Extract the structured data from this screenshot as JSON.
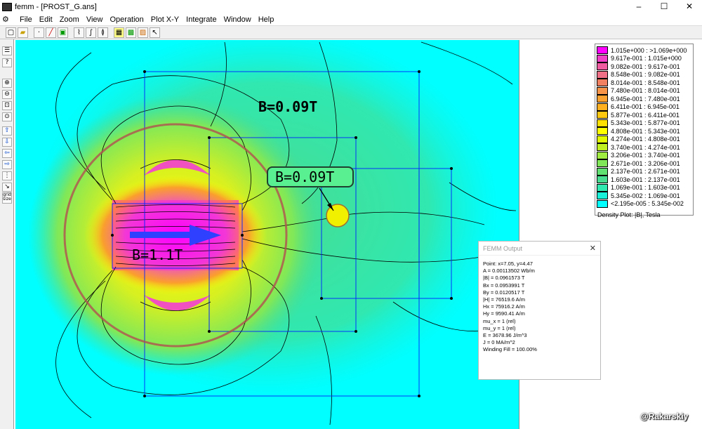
{
  "window": {
    "title": "femm - [PROST_G.ans]",
    "min": "–",
    "max": "☐",
    "close": "✕"
  },
  "menu": [
    "File",
    "Edit",
    "Zoom",
    "View",
    "Operation",
    "Plot X-Y",
    "Integrate",
    "Window",
    "Help"
  ],
  "toolbar_icons": [
    "new-file-icon",
    "open-file-icon",
    "point-mode-icon",
    "line-mode-icon",
    "area-mode-icon",
    "plot-xy-icon",
    "integrate-icon",
    "circuit-icon",
    "density-plot-icon",
    "vector-plot-icon",
    "hatch-icon",
    "select-arrow-icon"
  ],
  "left_tools": [
    "zoom-in-icon",
    "zoom-out-icon",
    "zoom-window-icon",
    "zoom-natural-icon",
    "pan-up-icon",
    "pan-down-icon",
    "pan-left-icon",
    "pan-right-icon",
    "grid-icon",
    "snap-icon",
    "grid-size-icon"
  ],
  "left_tools_labels": {
    "grid_size": "grid size"
  },
  "annotations": {
    "b1": "B=0.09T",
    "b2": "B=0.09T",
    "b3": "B=1.1T"
  },
  "legend": {
    "rows": [
      {
        "label": "1.015e+000 : >1.069e+000",
        "color": "#ff00ff"
      },
      {
        "label": "9.617e-001 : 1.015e+000",
        "color": "#f040c8"
      },
      {
        "label": "9.082e-001 : 9.617e-001",
        "color": "#f05ca0"
      },
      {
        "label": "8.548e-001 : 9.082e-001",
        "color": "#f07088"
      },
      {
        "label": "8.014e-001 : 8.548e-001",
        "color": "#f08060"
      },
      {
        "label": "7.480e-001 : 8.014e-001",
        "color": "#f89448"
      },
      {
        "label": "6.945e-001 : 7.480e-001",
        "color": "#fca030"
      },
      {
        "label": "6.411e-001 : 6.945e-001",
        "color": "#ffb020"
      },
      {
        "label": "5.877e-001 : 6.411e-001",
        "color": "#ffc810"
      },
      {
        "label": "5.343e-001 : 5.877e-001",
        "color": "#ffe000"
      },
      {
        "label": "4.808e-001 : 5.343e-001",
        "color": "#ffff00"
      },
      {
        "label": "4.274e-001 : 4.808e-001",
        "color": "#e0f800"
      },
      {
        "label": "3.740e-001 : 4.274e-001",
        "color": "#c0f020"
      },
      {
        "label": "3.206e-001 : 3.740e-001",
        "color": "#a0ec40"
      },
      {
        "label": "2.671e-001 : 3.206e-001",
        "color": "#80e858"
      },
      {
        "label": "2.137e-001 : 2.671e-001",
        "color": "#60e070"
      },
      {
        "label": "1.603e-001 : 2.137e-001",
        "color": "#48dc90"
      },
      {
        "label": "1.069e-001 : 1.603e-001",
        "color": "#30e8b0"
      },
      {
        "label": "5.345e-002 : 1.069e-001",
        "color": "#18f0d8"
      },
      {
        "label": "<2.195e-005 : 5.345e-002",
        "color": "#00ffff"
      }
    ],
    "title": "Density Plot: |B|, Tesla"
  },
  "output": {
    "title": "FEMM Output",
    "close": "✕",
    "lines": [
      "Point: x=7.05, y=4.47",
      "A  = 0.00113502 Wb/m",
      "|B| = 0.0961573 T",
      "Bx  = 0.0953991 T",
      "By  = 0.0120517 T",
      "|H| = 76519.6 A/m",
      "Hx  = 75916.2 A/m",
      "Hy  = 9590.41 A/m",
      "mu_x = 1 (rel)",
      "mu_y = 1 (rel)",
      "E   = 3678.96 J/m^3",
      "J   = 0 MA/m^2",
      "Winding Fill = 100.00%"
    ]
  },
  "watermark": "@Rakarskiy"
}
